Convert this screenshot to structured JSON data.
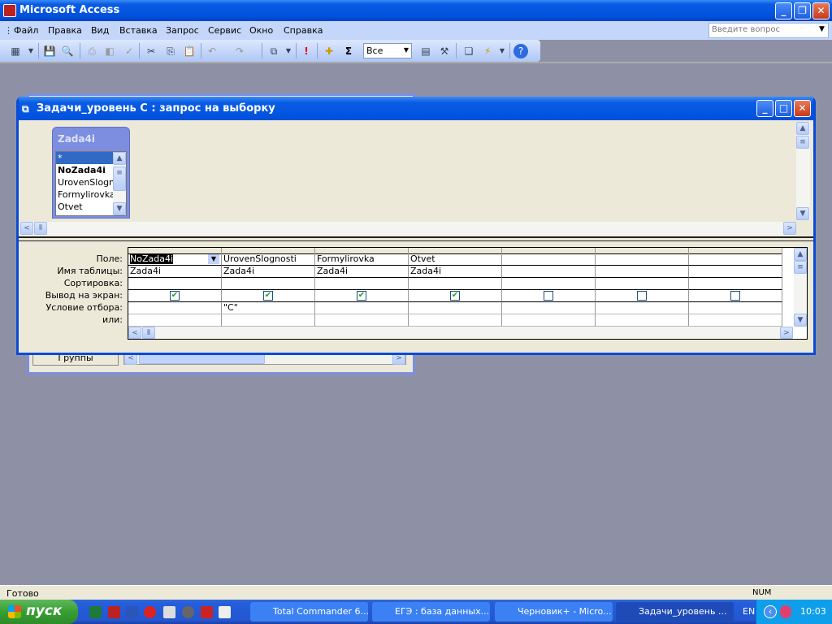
{
  "app": {
    "title": "Microsoft Access"
  },
  "menu": [
    "Файл",
    "Правка",
    "Вид",
    "Вставка",
    "Запрос",
    "Сервис",
    "Окно",
    "Справка"
  ],
  "help_search": {
    "placeholder": "Введите вопрос"
  },
  "toolbar": {
    "totals_symbol": "Σ",
    "top_values": "Все"
  },
  "background_window": {
    "button_label": "Группы"
  },
  "query_window": {
    "title": "Задачи_уровень С : запрос на выборку",
    "table": {
      "name": "Zada4i",
      "fields": [
        "*",
        "NoZada4i",
        "UrovenSlognc",
        "Formylirovka",
        "Otvet"
      ]
    },
    "row_labels": [
      "Поле:",
      "Имя таблицы:",
      "Сортировка:",
      "Вывод на экран:",
      "Условие отбора:",
      "или:"
    ],
    "columns": [
      {
        "field": "NoZada4i",
        "table": "Zada4i",
        "sort": "",
        "show": true,
        "criteria": "",
        "or": ""
      },
      {
        "field": "UrovenSlognosti",
        "table": "Zada4i",
        "sort": "",
        "show": true,
        "criteria": "\"C\"",
        "or": ""
      },
      {
        "field": "Formylirovka",
        "table": "Zada4i",
        "sort": "",
        "show": true,
        "criteria": "",
        "or": ""
      },
      {
        "field": "Otvet",
        "table": "Zada4i",
        "sort": "",
        "show": true,
        "criteria": "",
        "or": ""
      },
      {
        "field": "",
        "table": "",
        "sort": "",
        "show": false,
        "criteria": "",
        "or": ""
      },
      {
        "field": "",
        "table": "",
        "sort": "",
        "show": false,
        "criteria": "",
        "or": ""
      },
      {
        "field": "",
        "table": "",
        "sort": "",
        "show": false,
        "criteria": "",
        "or": ""
      }
    ]
  },
  "status": {
    "text": "Готово",
    "num": "NUM"
  },
  "taskbar": {
    "start": "пуск",
    "tasks": [
      "Total Commander 6...",
      "ЕГЭ : база данных...",
      "Черновик+ - Micro...",
      "Задачи_уровень ..."
    ],
    "lang": "EN",
    "clock": "10:03"
  }
}
